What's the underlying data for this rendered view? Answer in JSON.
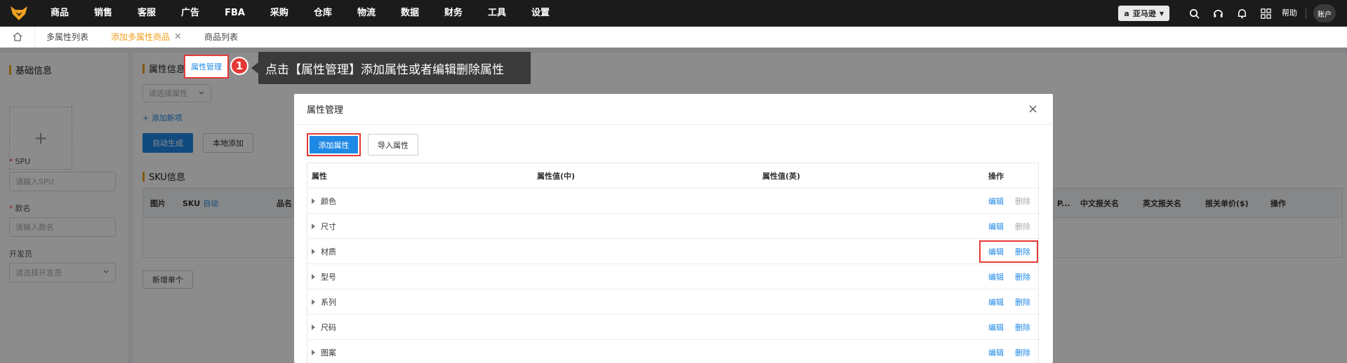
{
  "topnav": {
    "items": [
      "商品",
      "销售",
      "客服",
      "广告",
      "FBA",
      "采购",
      "仓库",
      "物流",
      "数据",
      "财务",
      "工具",
      "设置"
    ],
    "marketplace": "亚马逊",
    "help": "帮助",
    "account": "账户"
  },
  "tabs": [
    {
      "label": "多属性列表"
    },
    {
      "label": "添加多属性商品",
      "active": true
    },
    {
      "label": "商品列表"
    }
  ],
  "left_panel": {
    "basic_info": "基础信息",
    "spu_label": "SPU",
    "spu_placeholder": "请输入SPU",
    "style_label": "款名",
    "style_placeholder": "请输入款名",
    "developer_label": "开发员",
    "developer_placeholder": "请选择开发员"
  },
  "main": {
    "attr_info": "属性信息",
    "attr_manage": "属性管理",
    "select_attr_placeholder": "请选择属性",
    "add_new": "+ 添加新项",
    "auto_generate": "自动生成",
    "local_add": "本地添加",
    "sku_info": "SKU信息",
    "sku_headers": {
      "image": "图片",
      "sku": "SKU",
      "sku_auto": "自动",
      "product_name": "品名",
      "p_trunc": "P...",
      "cn_declare": "中文报关名",
      "en_declare": "英文报关名",
      "declare_price": "报关单价($)",
      "ops": "操作"
    },
    "add_single": "新增单个"
  },
  "callout": {
    "step": "1",
    "text": "点击【属性管理】添加属性或者编辑删除属性"
  },
  "modal": {
    "title": "属性管理",
    "add_attr": "添加属性",
    "import_attr": "导入属性",
    "columns": {
      "attr": "属性",
      "value_cn": "属性值(中)",
      "value_en": "属性值(英)",
      "ops": "操作"
    },
    "edit_label": "编辑",
    "delete_label": "删除",
    "rows": [
      {
        "name": "颜色",
        "deletable": false
      },
      {
        "name": "尺寸",
        "deletable": false
      },
      {
        "name": "材质",
        "deletable": true
      },
      {
        "name": "型号",
        "deletable": true
      },
      {
        "name": "系列",
        "deletable": true
      },
      {
        "name": "尺码",
        "deletable": true
      },
      {
        "name": "图案",
        "deletable": true
      }
    ]
  },
  "colors": {
    "accent": "#1e88e5",
    "brand": "#f0a020",
    "highlight": "#e53935"
  }
}
